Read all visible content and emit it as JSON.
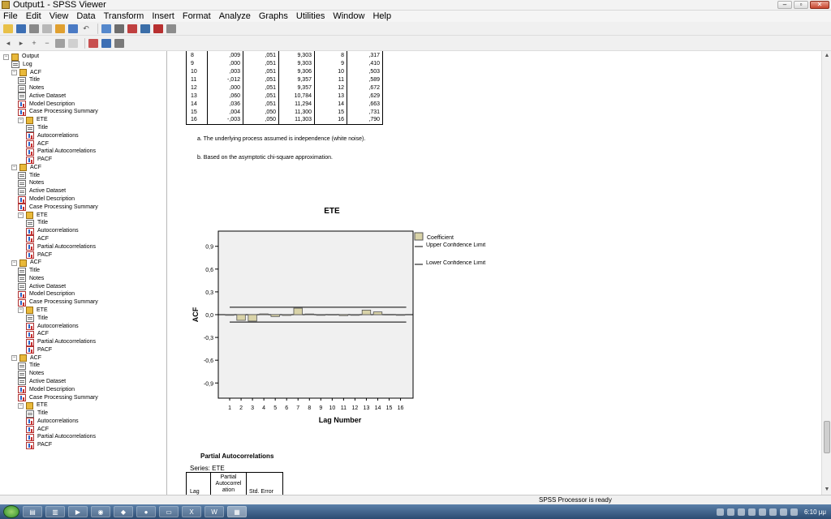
{
  "window": {
    "title": "Output1 - SPSS Viewer"
  },
  "menu": [
    "File",
    "Edit",
    "View",
    "Data",
    "Transform",
    "Insert",
    "Format",
    "Analyze",
    "Graphs",
    "Utilities",
    "Window",
    "Help"
  ],
  "outline": [
    {
      "label": "Output",
      "kind": "book",
      "level": 0
    },
    {
      "label": "Log",
      "kind": "doc",
      "level": 1
    },
    {
      "label": "ACF",
      "kind": "book",
      "level": 1
    },
    {
      "label": "Title",
      "kind": "doc",
      "level": 2
    },
    {
      "label": "Notes",
      "kind": "doc",
      "level": 2
    },
    {
      "label": "Active Dataset",
      "kind": "doc",
      "level": 2
    },
    {
      "label": "Model Description",
      "kind": "chart",
      "level": 2
    },
    {
      "label": "Case Processing Summary",
      "kind": "chart",
      "level": 2
    },
    {
      "label": "ETE",
      "kind": "book",
      "level": 2
    },
    {
      "label": "Title",
      "kind": "doc",
      "level": 3
    },
    {
      "label": "Autocorrelations",
      "kind": "chart",
      "level": 3
    },
    {
      "label": "ACF",
      "kind": "chart",
      "level": 3
    },
    {
      "label": "Partial Autocorrelations",
      "kind": "chart",
      "level": 3
    },
    {
      "label": "PACF",
      "kind": "chart",
      "level": 3
    },
    {
      "label": "ACF",
      "kind": "book",
      "level": 1
    },
    {
      "label": "Title",
      "kind": "doc",
      "level": 2
    },
    {
      "label": "Notes",
      "kind": "doc",
      "level": 2
    },
    {
      "label": "Active Dataset",
      "kind": "doc",
      "level": 2
    },
    {
      "label": "Model Description",
      "kind": "chart",
      "level": 2
    },
    {
      "label": "Case Processing Summary",
      "kind": "chart",
      "level": 2
    },
    {
      "label": "ETE",
      "kind": "book",
      "level": 2
    },
    {
      "label": "Title",
      "kind": "doc",
      "level": 3
    },
    {
      "label": "Autocorrelations",
      "kind": "chart",
      "level": 3
    },
    {
      "label": "ACF",
      "kind": "chart",
      "level": 3
    },
    {
      "label": "Partial Autocorrelations",
      "kind": "chart",
      "level": 3
    },
    {
      "label": "PACF",
      "kind": "chart",
      "level": 3
    },
    {
      "label": "ACF",
      "kind": "book",
      "level": 1
    },
    {
      "label": "Title",
      "kind": "doc",
      "level": 2
    },
    {
      "label": "Notes",
      "kind": "doc",
      "level": 2
    },
    {
      "label": "Active Dataset",
      "kind": "doc",
      "level": 2
    },
    {
      "label": "Model Description",
      "kind": "chart",
      "level": 2
    },
    {
      "label": "Case Processing Summary",
      "kind": "chart",
      "level": 2
    },
    {
      "label": "ETE",
      "kind": "book",
      "level": 2
    },
    {
      "label": "Title",
      "kind": "doc",
      "level": 3
    },
    {
      "label": "Autocorrelations",
      "kind": "chart",
      "level": 3
    },
    {
      "label": "ACF",
      "kind": "chart",
      "level": 3
    },
    {
      "label": "Partial Autocorrelations",
      "kind": "chart",
      "level": 3
    },
    {
      "label": "PACF",
      "kind": "chart",
      "level": 3
    },
    {
      "label": "ACF",
      "kind": "book",
      "level": 1
    },
    {
      "label": "Title",
      "kind": "doc",
      "level": 2
    },
    {
      "label": "Notes",
      "kind": "doc",
      "level": 2
    },
    {
      "label": "Active Dataset",
      "kind": "doc",
      "level": 2
    },
    {
      "label": "Model Description",
      "kind": "chart",
      "level": 2
    },
    {
      "label": "Case Processing Summary",
      "kind": "chart",
      "level": 2
    },
    {
      "label": "ETE",
      "kind": "book",
      "level": 2
    },
    {
      "label": "Title",
      "kind": "doc",
      "level": 3
    },
    {
      "label": "Autocorrelations",
      "kind": "chart",
      "level": 3
    },
    {
      "label": "ACF",
      "kind": "chart",
      "level": 3
    },
    {
      "label": "Partial Autocorrelations",
      "kind": "chart",
      "level": 3
    },
    {
      "label": "PACF",
      "kind": "chart",
      "level": 3
    }
  ],
  "acf_table": {
    "rows": [
      [
        "8",
        ",009",
        ",051",
        "9,303",
        "8",
        ",317"
      ],
      [
        "9",
        ",000",
        ",051",
        "9,303",
        "9",
        ",410"
      ],
      [
        "10",
        ",003",
        ",051",
        "9,306",
        "10",
        ",503"
      ],
      [
        "11",
        "-,012",
        ",051",
        "9,357",
        "11",
        ",589"
      ],
      [
        "12",
        ",000",
        ",051",
        "9,357",
        "12",
        ",672"
      ],
      [
        "13",
        ",060",
        ",051",
        "10,784",
        "13",
        ",629"
      ],
      [
        "14",
        ",036",
        ",051",
        "11,294",
        "14",
        ",663"
      ],
      [
        "15",
        ",004",
        ",050",
        "11,300",
        "15",
        ",731"
      ],
      [
        "16",
        "-,003",
        ",050",
        "11,303",
        "16",
        ",790"
      ]
    ],
    "footnotes": [
      "a. The underlying process assumed is independence (white noise).",
      "b. Based on the asymptotic chi-square approximation."
    ]
  },
  "chart_data": {
    "type": "bar",
    "title": "ETE",
    "xlabel": "Lag Number",
    "ylabel": "ACF",
    "categories": [
      "1",
      "2",
      "3",
      "4",
      "5",
      "6",
      "7",
      "8",
      "9",
      "10",
      "11",
      "12",
      "13",
      "14",
      "15",
      "16"
    ],
    "series": [
      {
        "name": "Coefficient",
        "values": [
          -0.002,
          -0.075,
          -0.085,
          0.01,
          -0.025,
          -0.01,
          0.085,
          0.009,
          0.0,
          0.003,
          -0.012,
          0.0,
          0.06,
          0.036,
          0.004,
          -0.003
        ]
      },
      {
        "name": "Upper Confidence Limit",
        "values": [
          0.098,
          0.098,
          0.098,
          0.098,
          0.098,
          0.098,
          0.098,
          0.098,
          0.098,
          0.098,
          0.098,
          0.098,
          0.098,
          0.098,
          0.098,
          0.098
        ]
      },
      {
        "name": "Lower Confidence Limit",
        "values": [
          -0.098,
          -0.098,
          -0.098,
          -0.098,
          -0.098,
          -0.098,
          -0.098,
          -0.098,
          -0.098,
          -0.098,
          -0.098,
          -0.098,
          -0.098,
          -0.098,
          -0.098,
          -0.098
        ]
      }
    ],
    "yticks": [
      0.9,
      0.6,
      0.3,
      0.0,
      -0.3,
      -0.6,
      -0.9
    ],
    "ytick_labels": [
      "0,9",
      "0,6",
      "0,3",
      "0,0",
      "-0,3",
      "-0,6",
      "-0,9"
    ],
    "ylim": [
      -1.1,
      1.1
    ],
    "legend": "right",
    "colors": {
      "bar": "#d9d3a8",
      "bar_border": "#555555",
      "plot_bg": "#f0f0f0",
      "line": "#000000"
    }
  },
  "pacf": {
    "title": "Partial Autocorrelations",
    "series_label": "Series: ETE",
    "col_lag": "Lag",
    "col_pacf": "Partial Autocorrel ation",
    "col_se": "Std. Error"
  },
  "statusbar": {
    "text": "SPSS Processor  is ready"
  },
  "taskbar": {
    "clock": "6:10 μμ"
  }
}
